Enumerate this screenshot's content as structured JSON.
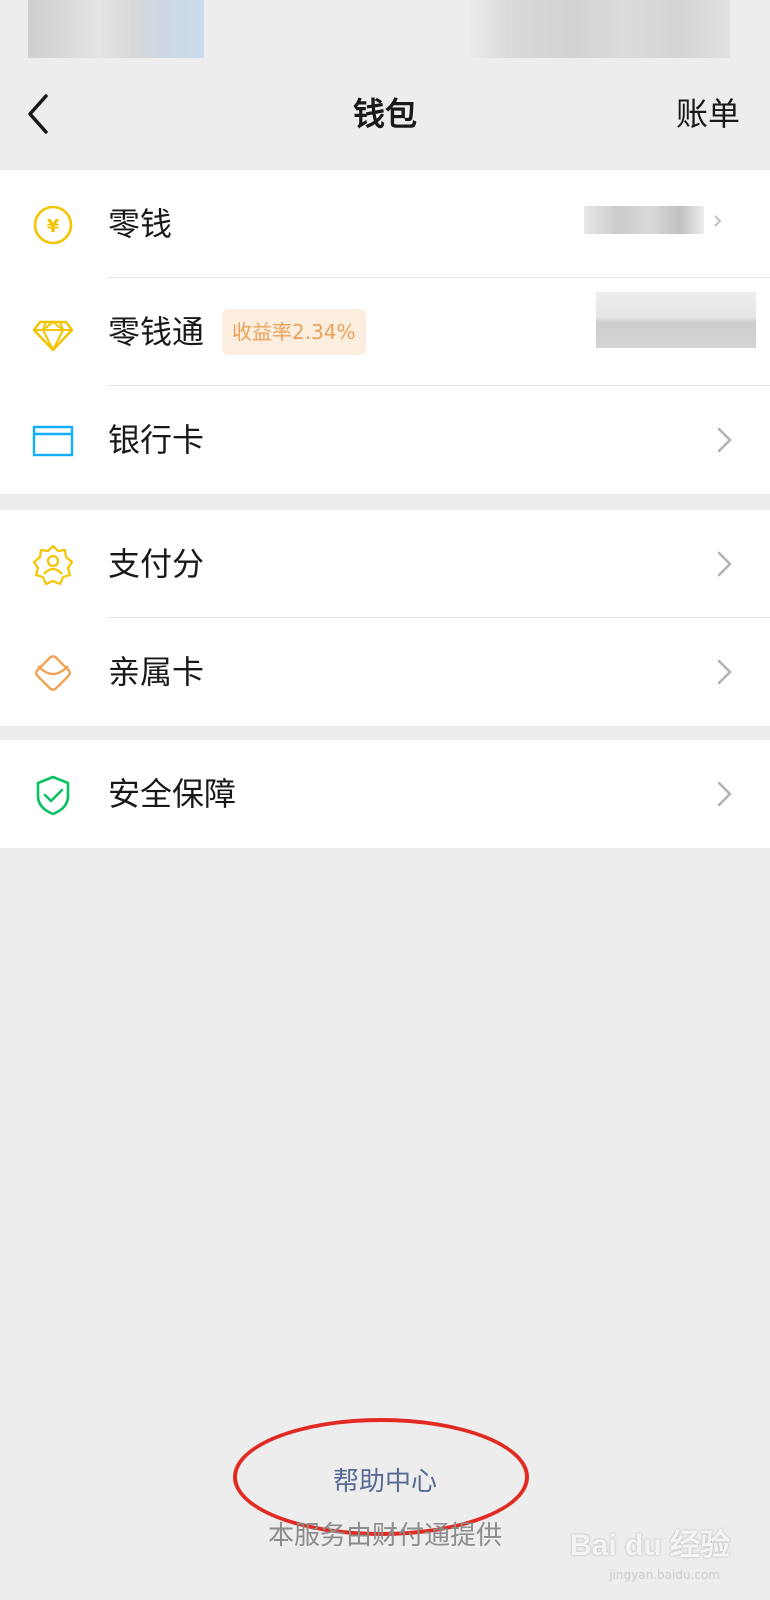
{
  "nav": {
    "title": "钱包",
    "right_label": "账单"
  },
  "groups": [
    {
      "items": [
        {
          "label": "零钱",
          "icon": "yuan-coin-icon",
          "color": "#f5c400"
        },
        {
          "label": "零钱通",
          "icon": "diamond-icon",
          "color": "#f5c400",
          "badge": "收益率2.34%"
        },
        {
          "label": "银行卡",
          "icon": "bank-card-icon",
          "color": "#10aeff"
        }
      ]
    },
    {
      "items": [
        {
          "label": "支付分",
          "icon": "credit-score-icon",
          "color": "#f5c400"
        },
        {
          "label": "亲属卡",
          "icon": "family-card-icon",
          "color": "#f0a050"
        }
      ]
    },
    {
      "items": [
        {
          "label": "安全保障",
          "icon": "shield-check-icon",
          "color": "#07c160"
        }
      ]
    }
  ],
  "footer": {
    "help_link": "帮助中心",
    "provider_text": "本服务由财付通提供"
  },
  "watermark": {
    "brand": "Bai du 经验",
    "url": "jingyan.baidu.com"
  },
  "colors": {
    "background": "#ededed",
    "link": "#576b95",
    "annotation_red": "#e02a22",
    "badge_text": "#e9a15b",
    "badge_bg": "#fbeede"
  }
}
